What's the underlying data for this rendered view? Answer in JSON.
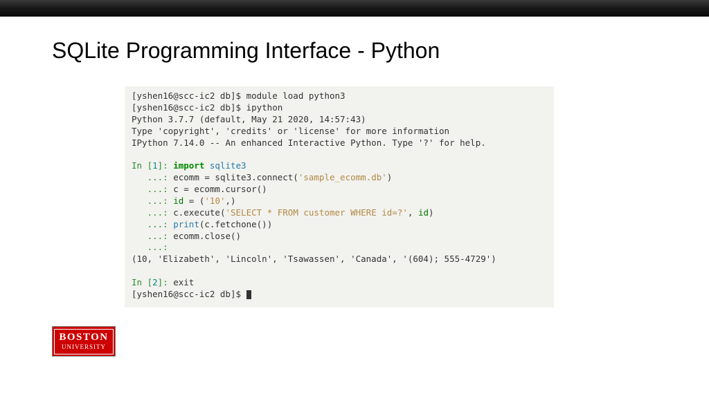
{
  "title": "SQLite Programming Interface - Python",
  "term": {
    "l1a": "[yshen16@scc-ic2 db]$ ",
    "l1b": "module load python3",
    "l2a": "[yshen16@scc-ic2 db]$ ",
    "l2b": "ipython",
    "l3": "Python 3.7.7 (default, May 21 2020, 14:57:43)",
    "l4": "Type 'copyright', 'credits' or 'license' for more information",
    "l5": "IPython 7.14.0 -- An enhanced Interactive Python. Type '?' for help.",
    "l6": "",
    "in1p": "In [",
    "in1n": "1",
    "in1s": "]: ",
    "imp": "import",
    "sp": " ",
    "sql": "sqlite3",
    "cont": "   ...: ",
    "c1": "ecomm = sqlite3.connect(",
    "s1": "'sample_ecomm.db'",
    "c1b": ")",
    "c2": "c = ecomm.cursor()",
    "c3a": "id",
    "c3b": " = (",
    "s2": "'10'",
    "c3c": ",)",
    "c4a": "c.execute(",
    "s3": "'SELECT * FROM customer WHERE id=?'",
    "c4b": ", ",
    "c4c": "id",
    "c4d": ")",
    "c5pr": "print",
    "c5": "(c.fetchone())",
    "c6": "ecomm.close()",
    "out": "(10, 'Elizabeth', 'Lincoln', 'Tsawassen', 'Canada', '(604); 555-4729')",
    "in2p": "In [",
    "in2n": "2",
    "in2s": "]: ",
    "exit": "exit",
    "lastp": "[yshen16@scc-ic2 db]$ "
  },
  "logo": {
    "line1": "BOSTON",
    "line2": "UNIVERSITY"
  }
}
